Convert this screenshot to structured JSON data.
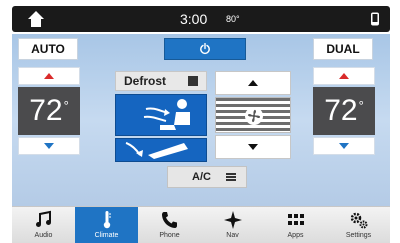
{
  "status": {
    "time": "3:00",
    "outside_temp": "80°"
  },
  "climate": {
    "auto_label": "AUTO",
    "dual_label": "DUAL",
    "power_icon": "power-icon",
    "left_temp": "72",
    "right_temp": "72",
    "defrost_label": "Defrost",
    "ac_label": "A/C"
  },
  "nav": {
    "items": [
      {
        "label": "Audio",
        "icon": "music-note-icon",
        "active": false
      },
      {
        "label": "Climate",
        "icon": "thermometer-icon",
        "active": true
      },
      {
        "label": "Phone",
        "icon": "phone-icon",
        "active": false
      },
      {
        "label": "Nav",
        "icon": "compass-icon",
        "active": false
      },
      {
        "label": "Apps",
        "icon": "apps-grid-icon",
        "active": false
      },
      {
        "label": "Settings",
        "icon": "gears-icon",
        "active": false
      }
    ]
  },
  "colors": {
    "accent": "#1f74c4",
    "panel_bg": "#b4cbe6",
    "status_bar": "#1a1a1a",
    "temp_bg": "#4b4b4d",
    "up_arrow": "#d92b2b",
    "down_arrow": "#1f74c4"
  }
}
